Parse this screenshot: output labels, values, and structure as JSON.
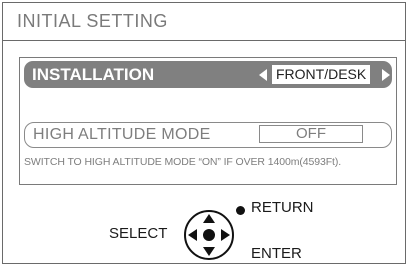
{
  "title": "INITIAL SETTING",
  "installation": {
    "label": "INSTALLATION",
    "value": "FRONT/DESK"
  },
  "high_altitude": {
    "label": "HIGH ALTITUDE MODE",
    "value": "OFF",
    "note": "SWITCH TO HIGH ALTITUDE MODE “ON” IF OVER 1400m(4593Ft)."
  },
  "controls": {
    "select": "SELECT",
    "return": "RETURN",
    "enter": "ENTER"
  },
  "icons": {
    "dpad": "directional-pad-icon",
    "left": "triangle-left-icon",
    "right": "triangle-right-icon",
    "dot": "return-dot-icon"
  },
  "colors": {
    "highlight_bg": "#808080",
    "border": "#6a6a6a",
    "dim_text": "#7e7e7e"
  }
}
